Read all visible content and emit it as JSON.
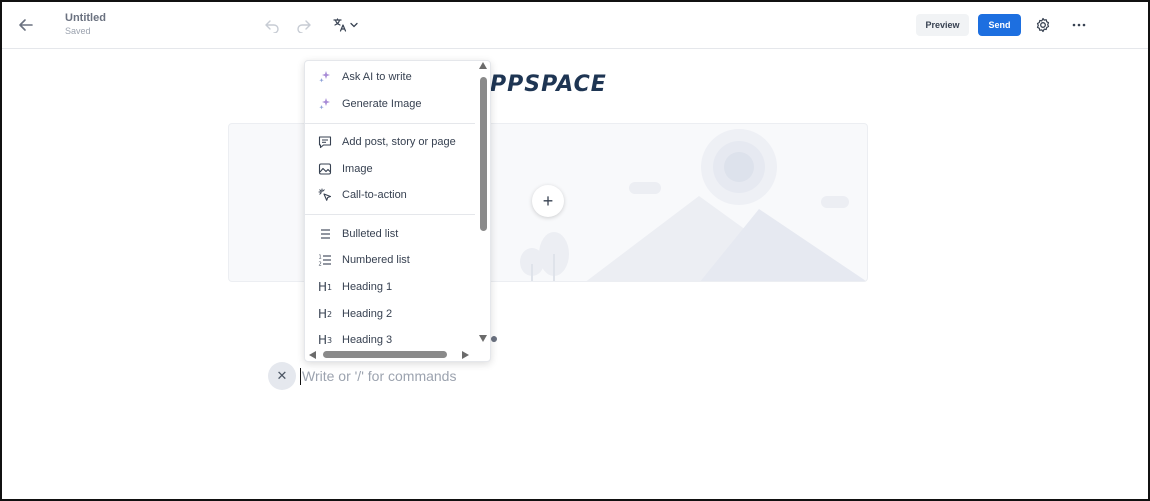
{
  "header": {
    "back_icon": "arrow-left-icon",
    "title": "Untitled",
    "status": "Saved",
    "undo_icon": "undo-icon",
    "redo_icon": "redo-icon",
    "translate_icon": "translate-icon",
    "preview_label": "Preview",
    "send_label": "Send",
    "send_color": "#1d6fe0",
    "settings_icon": "gear-icon",
    "more_icon": "more-horizontal-icon"
  },
  "canvas": {
    "logo_text": "APPSPACE",
    "logo_color": "#1e3553",
    "image_placeholder_icon": "landscape-placeholder-icon",
    "add_button_symbol": "+",
    "close_symbol": "✕",
    "editor_placeholder": "Write or '/' for commands",
    "dots_fragment": "●●●"
  },
  "command_menu": {
    "groups": [
      {
        "items": [
          {
            "label": "Ask AI to write",
            "icon": "sparkles-icon"
          },
          {
            "label": "Generate Image",
            "icon": "sparkles-icon"
          }
        ]
      },
      {
        "items": [
          {
            "label": "Add post, story or page",
            "icon": "message-square-icon"
          },
          {
            "label": "Image",
            "icon": "image-icon"
          },
          {
            "label": "Call-to-action",
            "icon": "cursor-click-icon"
          }
        ]
      },
      {
        "items": [
          {
            "label": "Bulleted list",
            "icon": "list-icon"
          },
          {
            "label": "Numbered list",
            "icon": "numbered-list-icon"
          },
          {
            "label": "Heading 1",
            "icon": "heading-1-icon"
          },
          {
            "label": "Heading 2",
            "icon": "heading-2-icon"
          },
          {
            "label": "Heading 3",
            "icon": "heading-3-icon"
          }
        ]
      }
    ]
  }
}
